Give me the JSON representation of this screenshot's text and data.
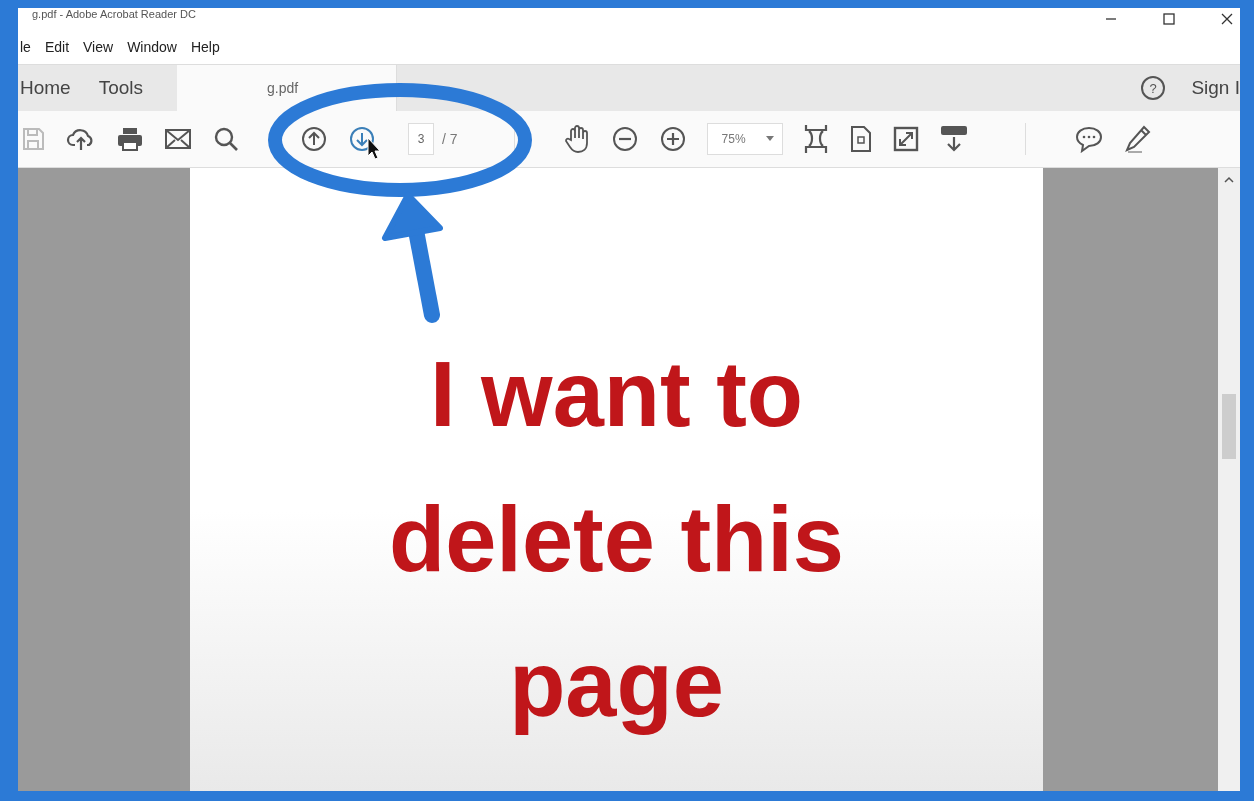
{
  "window": {
    "title": "g.pdf - Adobe Acrobat Reader DC"
  },
  "menu": [
    "le",
    "Edit",
    "View",
    "Window",
    "Help"
  ],
  "tabs": [
    {
      "label": "Home",
      "selected": false
    },
    {
      "label": "Tools",
      "selected": false
    },
    {
      "label": "g.pdf",
      "selected": true
    }
  ],
  "account": {
    "help": "?",
    "sign_in": "Sign I"
  },
  "toolbar": {
    "page_number": "3",
    "page_count": "/ 7",
    "zoom": "75%"
  },
  "document": {
    "lines": [
      "I want to",
      "delete this",
      "page"
    ]
  }
}
